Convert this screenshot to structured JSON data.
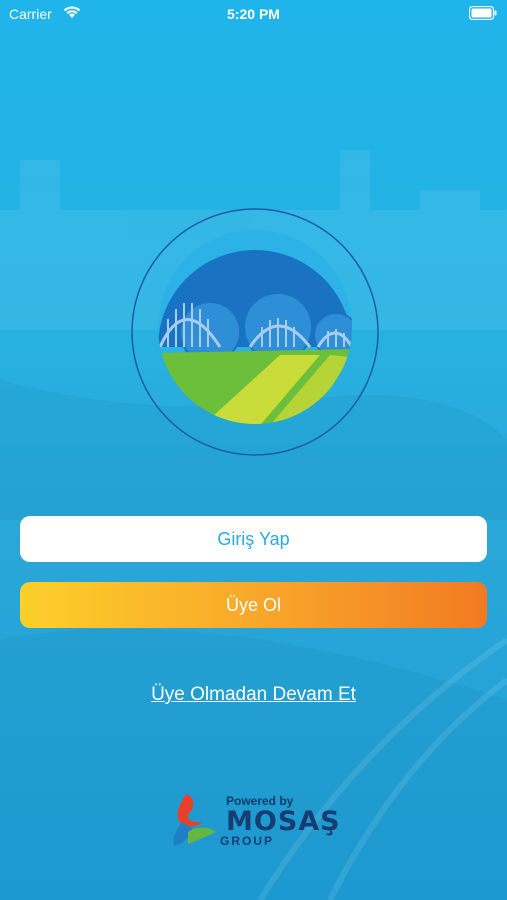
{
  "status_bar": {
    "carrier": "Carrier",
    "time": "5:20 PM",
    "wifi_icon": "wifi-icon",
    "battery_icon": "battery-icon"
  },
  "logo": {
    "icon": "bridge-gear-field-logo",
    "colors": {
      "sky": "#1a73c2",
      "green": "#6cbf3b",
      "yellow_green": "#c9dc3a",
      "ring": "#1e5aa8"
    }
  },
  "buttons": {
    "login_label": "Giriş Yap",
    "register_label": "Üye Ol"
  },
  "guest_link_label": "Üye Olmadan Devam Et",
  "footer": {
    "powered_by": "Powered by",
    "brand": "MOSAŞ",
    "brand_sub": "GROUP"
  },
  "colors": {
    "background": "#23b0e6",
    "login_text": "#2aa9e0",
    "register_gradient_start": "#fccf2a",
    "register_gradient_end": "#f27a22"
  }
}
